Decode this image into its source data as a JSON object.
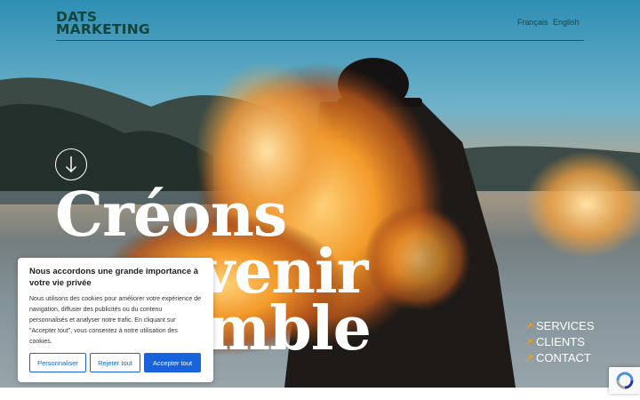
{
  "header": {
    "logo_line1": "DATS",
    "logo_line2": "MARKETING",
    "languages": [
      "Français",
      "English"
    ]
  },
  "hero": {
    "headline_lines": [
      "Créons",
      "un avenir",
      "ensemble"
    ],
    "scroll_icon": "arrow-down-icon"
  },
  "nav": {
    "items": [
      "SERVICES",
      "CLIENTS",
      "CONTACT"
    ],
    "arrow_icon": "arrow-up-right-icon"
  },
  "cookie_banner": {
    "title": "Nous accordons une grande importance à votre vie privée",
    "body": "Nous utilisons des cookies pour améliorer votre expérience de navigation, diffuser des publicités ou du contenu personnalisés et analyser notre trafic. En cliquant sur \"Accepter tout\", vous consentez à notre utilisation des cookies.",
    "customize_label": "Personnaliser",
    "reject_label": "Rejeter tout",
    "accept_label": "Accepter tout"
  },
  "colors": {
    "brand": "#15443d",
    "accent_arrow": "#f29b1d",
    "button_blue": "#1863dc"
  },
  "recaptcha_icon": "recaptcha-icon"
}
